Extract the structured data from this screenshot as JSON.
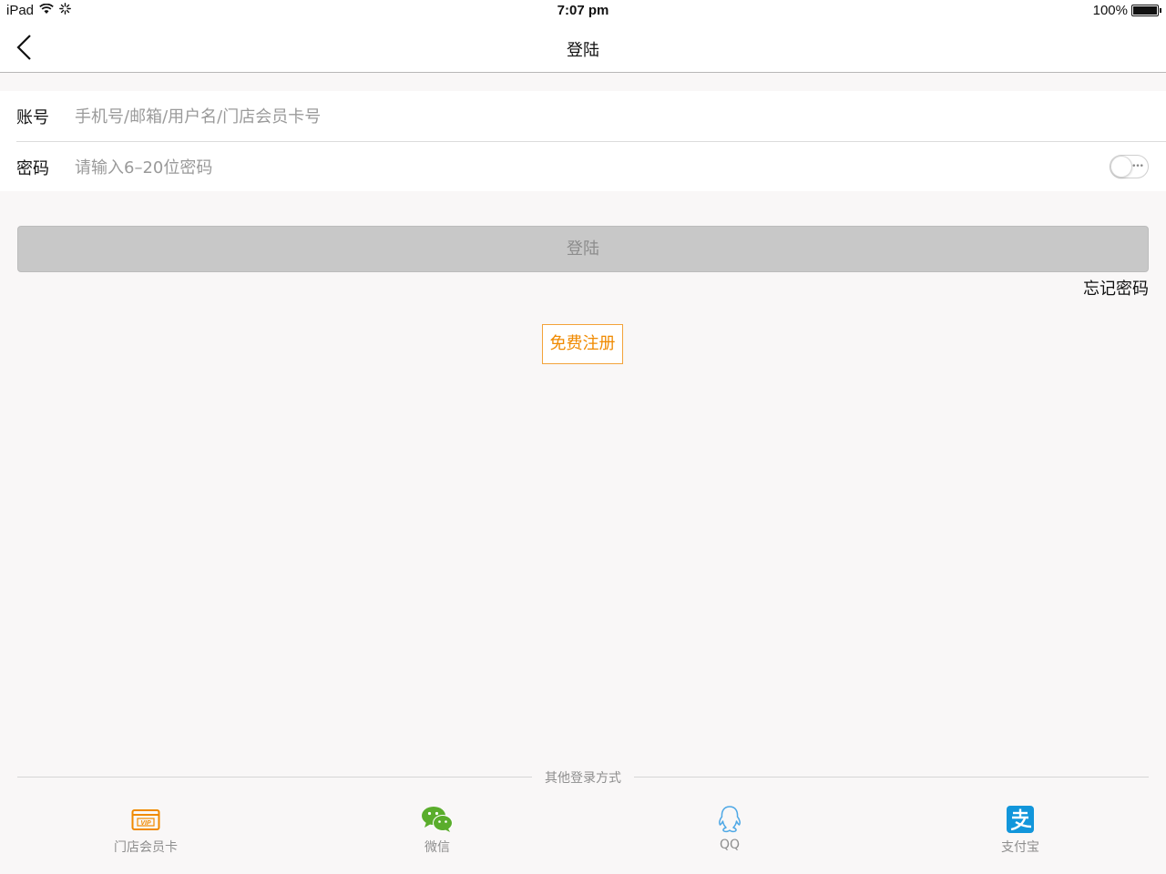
{
  "status_bar": {
    "device": "iPad",
    "time": "7:07 pm",
    "battery": "100%"
  },
  "nav": {
    "title": "登陆",
    "back_icon": "chevron-left-icon"
  },
  "form": {
    "account_label": "账号",
    "account_placeholder": "手机号/邮箱/用户名/门店会员卡号",
    "account_value": "",
    "password_label": "密码",
    "password_placeholder": "请输入6–20位密码",
    "password_value": "",
    "password_visibility_icon": "toggle-icon"
  },
  "actions": {
    "login_label": "登陆",
    "forgot_label": "忘记密码",
    "register_label": "免费注册"
  },
  "other_login": {
    "divider_text": "其他登录方式",
    "methods": [
      {
        "label": "门店会员卡",
        "icon": "vip-card-icon",
        "color": "#f08a00"
      },
      {
        "label": "微信",
        "icon": "wechat-icon",
        "color": "#5aad2c"
      },
      {
        "label": "QQ",
        "icon": "qq-icon",
        "color": "#4ea8e6"
      },
      {
        "label": "支付宝",
        "icon": "alipay-icon",
        "color": "#1296db"
      }
    ]
  },
  "colors": {
    "accent": "#f08a00",
    "button_disabled": "#c8c8c8",
    "background": "#f9f7f7"
  }
}
